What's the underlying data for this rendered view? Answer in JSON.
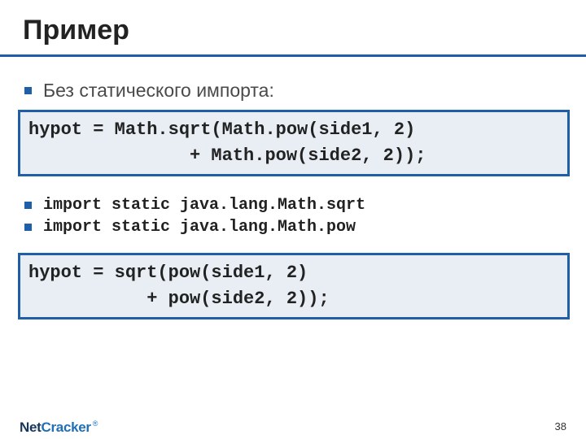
{
  "title": "Пример",
  "bullet1": "Без статического импорта:",
  "code1_line1": "hypot = Math.sqrt(Math.pow(side1, 2)",
  "code1_line2": "               + Math.pow(side2, 2));",
  "import1": "import static java.lang.Math.sqrt",
  "import2": "import static java.lang.Math.pow",
  "code2_line1": "hypot = sqrt(pow(side1, 2)",
  "code2_line2": "           + pow(side2, 2));",
  "logo_net": "Net",
  "logo_cracker": "Cracker",
  "logo_reg": "®",
  "page_number": "38"
}
